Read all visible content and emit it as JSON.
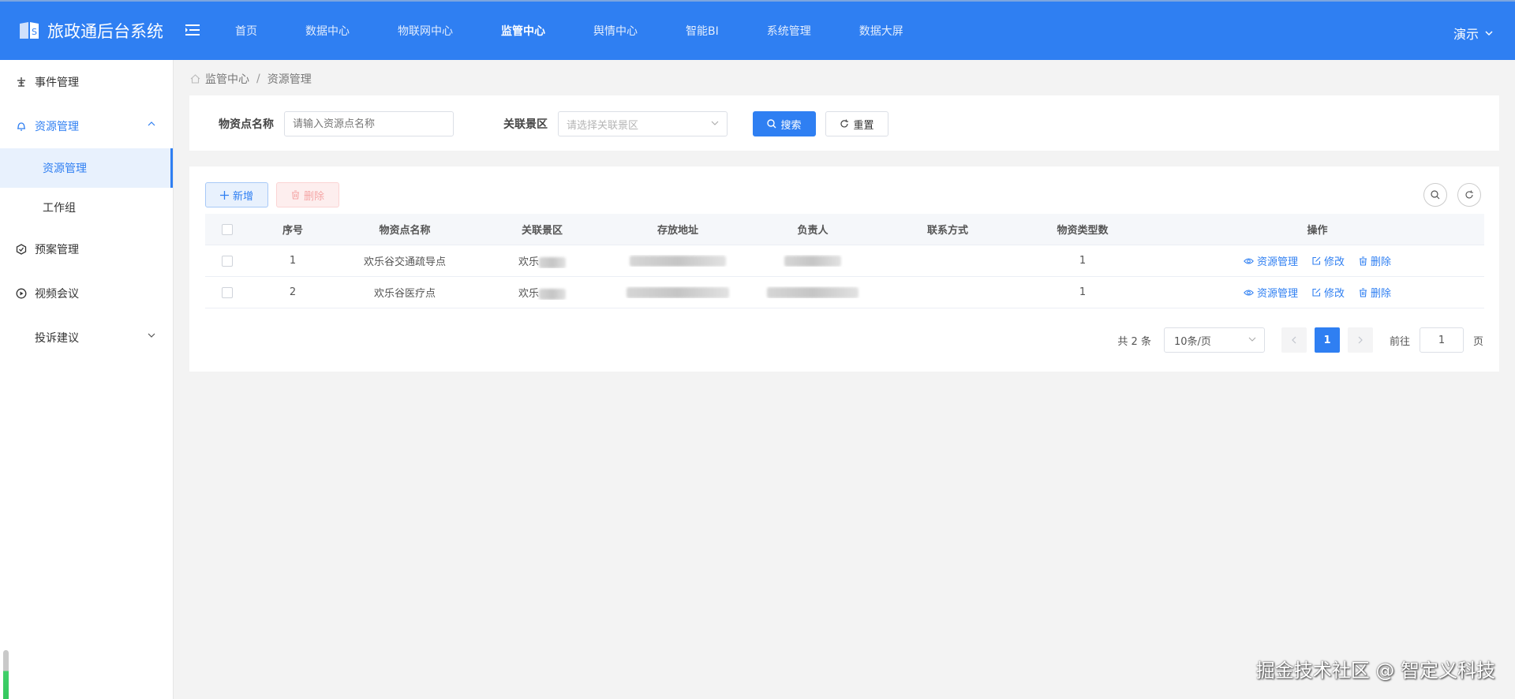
{
  "app": {
    "title": "旅政通后台系统",
    "user": "演示"
  },
  "nav": [
    {
      "label": "首页",
      "active": false
    },
    {
      "label": "数据中心",
      "active": false
    },
    {
      "label": "物联网中心",
      "active": false
    },
    {
      "label": "监管中心",
      "active": true
    },
    {
      "label": "舆情中心",
      "active": false
    },
    {
      "label": "智能BI",
      "active": false
    },
    {
      "label": "系统管理",
      "active": false
    },
    {
      "label": "数据大屏",
      "active": false
    }
  ],
  "sidebar": {
    "items": [
      {
        "label": "事件管理",
        "icon": "event-icon"
      },
      {
        "label": "资源管理",
        "icon": "bell-icon",
        "open": true,
        "children": [
          {
            "label": "资源管理",
            "active": true
          },
          {
            "label": "工作组"
          }
        ]
      },
      {
        "label": "预案管理",
        "icon": "plan-icon"
      },
      {
        "label": "视频会议",
        "icon": "video-icon"
      },
      {
        "label": "投诉建议",
        "icon": ""
      }
    ]
  },
  "breadcrumb": {
    "parent": "监管中心",
    "current": "资源管理"
  },
  "search": {
    "name_label": "物资点名称",
    "name_placeholder": "请输入资源点名称",
    "area_label": "关联景区",
    "area_placeholder": "请选择关联景区",
    "search_btn": "搜索",
    "reset_btn": "重置"
  },
  "toolbar": {
    "add": "新增",
    "delete": "删除"
  },
  "table": {
    "headers": [
      "",
      "序号",
      "物资点名称",
      "关联景区",
      "存放地址",
      "负责人",
      "联系方式",
      "物资类型数",
      "操作"
    ],
    "rows": [
      {
        "index": "1",
        "name": "欢乐谷交通疏导点",
        "area": "欢乐",
        "types": "1"
      },
      {
        "index": "2",
        "name": "欢乐谷医疗点",
        "area": "欢乐",
        "types": "1"
      }
    ],
    "actions": {
      "manage": "资源管理",
      "edit": "修改",
      "delete": "删除"
    }
  },
  "pagination": {
    "total": "共 2 条",
    "page_size": "10条/页",
    "current": "1",
    "goto_prefix": "前往",
    "goto_value": "1",
    "goto_suffix": "页"
  },
  "watermark": "掘金技术社区 @ 智定义科技",
  "colors": {
    "primary": "#2f7ff2",
    "danger_light": "#fdeeee"
  }
}
